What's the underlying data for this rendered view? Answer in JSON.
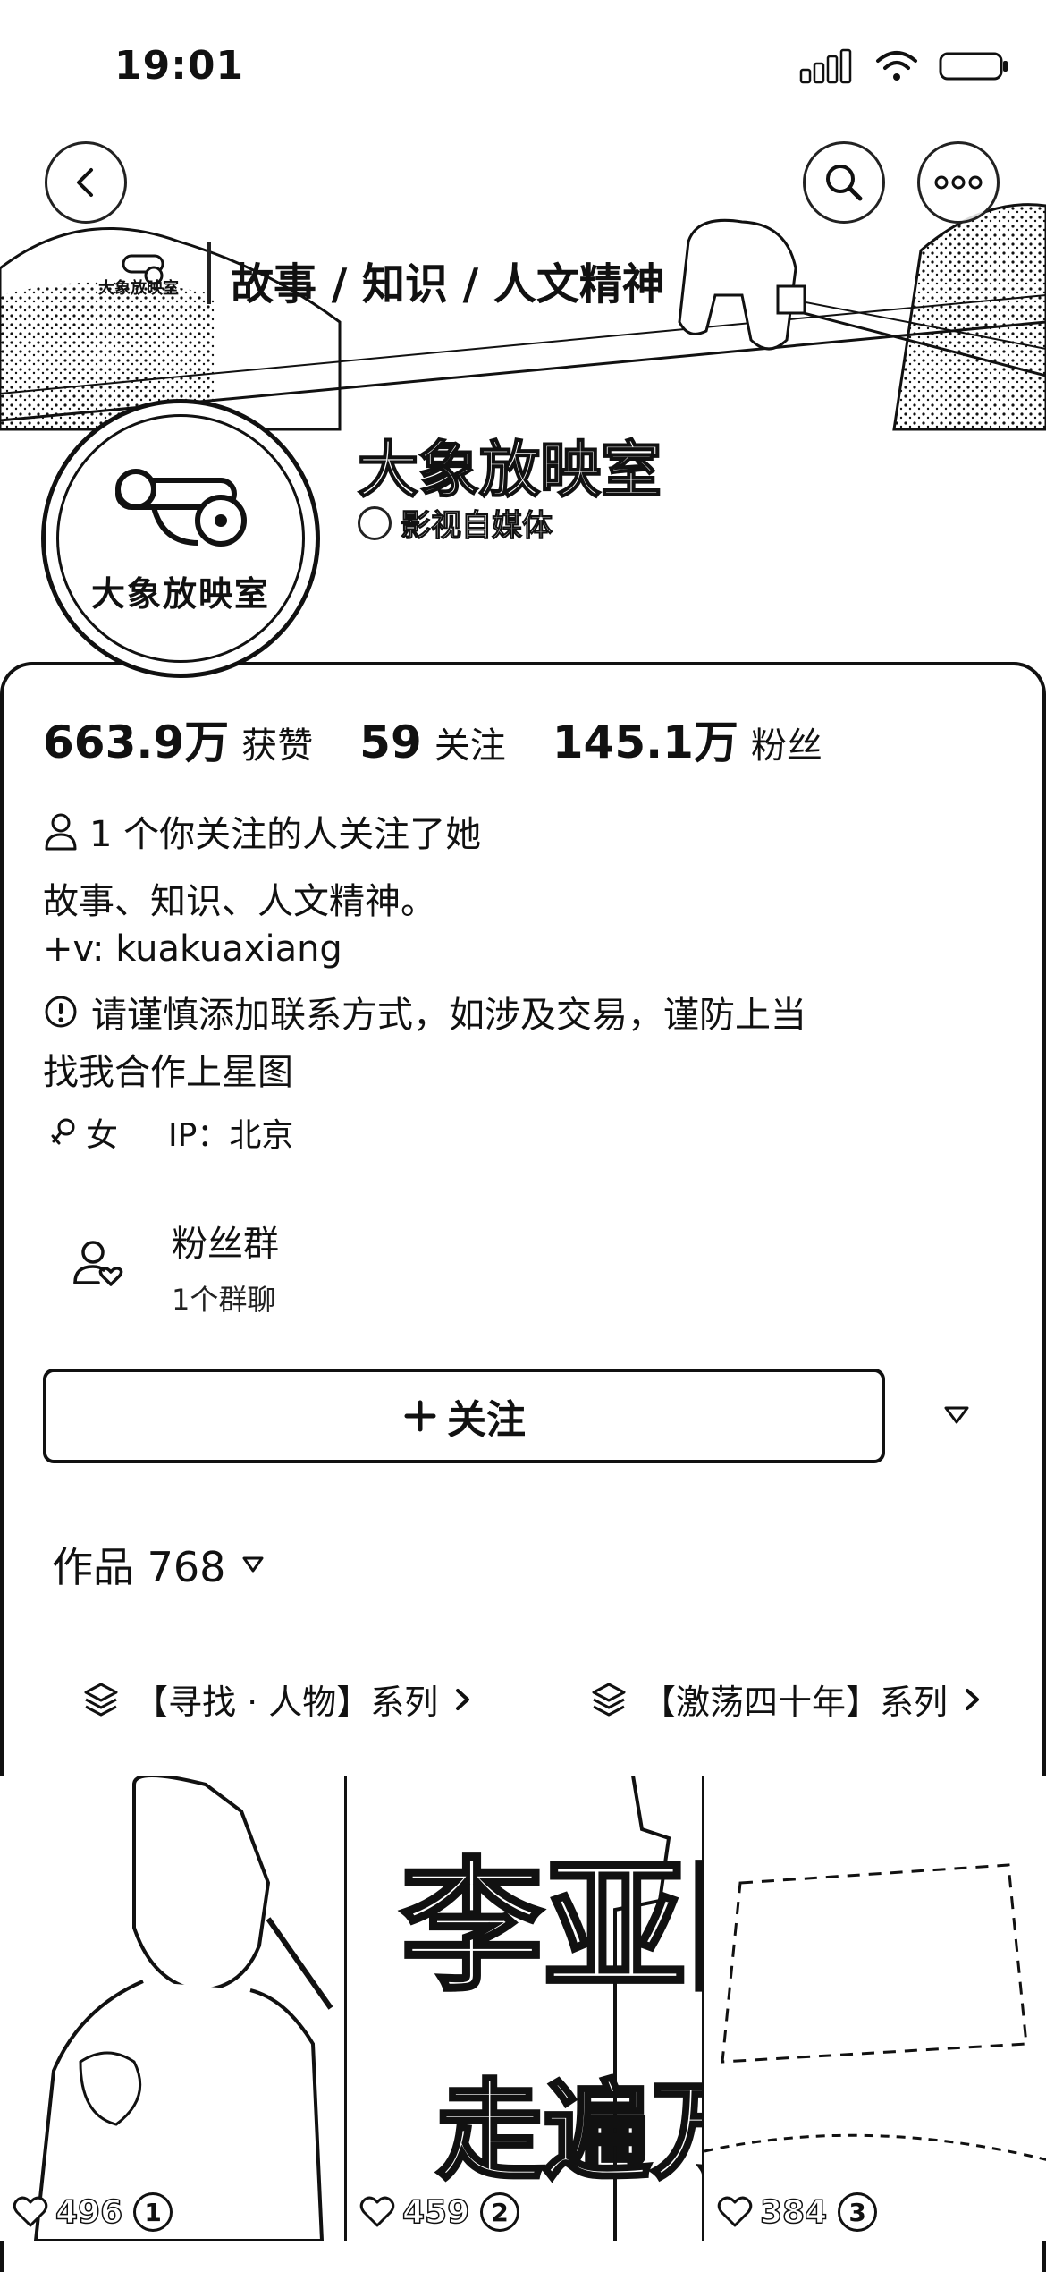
{
  "status_bar": {
    "time": "19:01"
  },
  "banner": {
    "text": "故事 / 知识 / 人文精神",
    "logo_small_text": "大象放映室"
  },
  "profile": {
    "avatar_text": "大象放映室",
    "name": "大象放映室",
    "tag": "影视自媒体"
  },
  "stats": [
    {
      "value": "663.9万",
      "label": "获赞"
    },
    {
      "value": "59",
      "label": "关注"
    },
    {
      "value": "145.1万",
      "label": "粉丝"
    }
  ],
  "follow_hint": "1 个你关注的人关注了她",
  "bio": {
    "line1": "故事、知识、人文精神。",
    "line2": "+v: kuakuaxiang",
    "warning": "请谨慎添加联系方式，如涉及交易，谨防上当",
    "line4": "找我合作上星图"
  },
  "meta": {
    "gender": "女",
    "ip": "IP：北京"
  },
  "fan_group": {
    "title": "粉丝群",
    "subtitle": "1个群聊"
  },
  "follow_button": {
    "label": "关注"
  },
  "works": {
    "label": "作品 768"
  },
  "series": [
    {
      "label": "【寻找 · 人物】系列"
    },
    {
      "label": "【激荡四十年】系列"
    }
  ],
  "videos": [
    {
      "likes": "496",
      "rank": "1"
    },
    {
      "likes": "459",
      "rank": "2",
      "title_top": "李亚刚",
      "title_bottom": "走遍万疆"
    },
    {
      "likes": "384",
      "rank": "3"
    }
  ],
  "icons": {
    "back": "back-icon",
    "search": "search-icon",
    "more": "more-icon",
    "person": "person-icon",
    "warning": "warning-icon",
    "female": "female-icon",
    "fan_group": "fan-group-icon",
    "plus": "plus-icon",
    "caret": "caret-down-icon",
    "layers": "layers-icon",
    "chevron": "chevron-right-icon",
    "heart": "heart-icon"
  }
}
